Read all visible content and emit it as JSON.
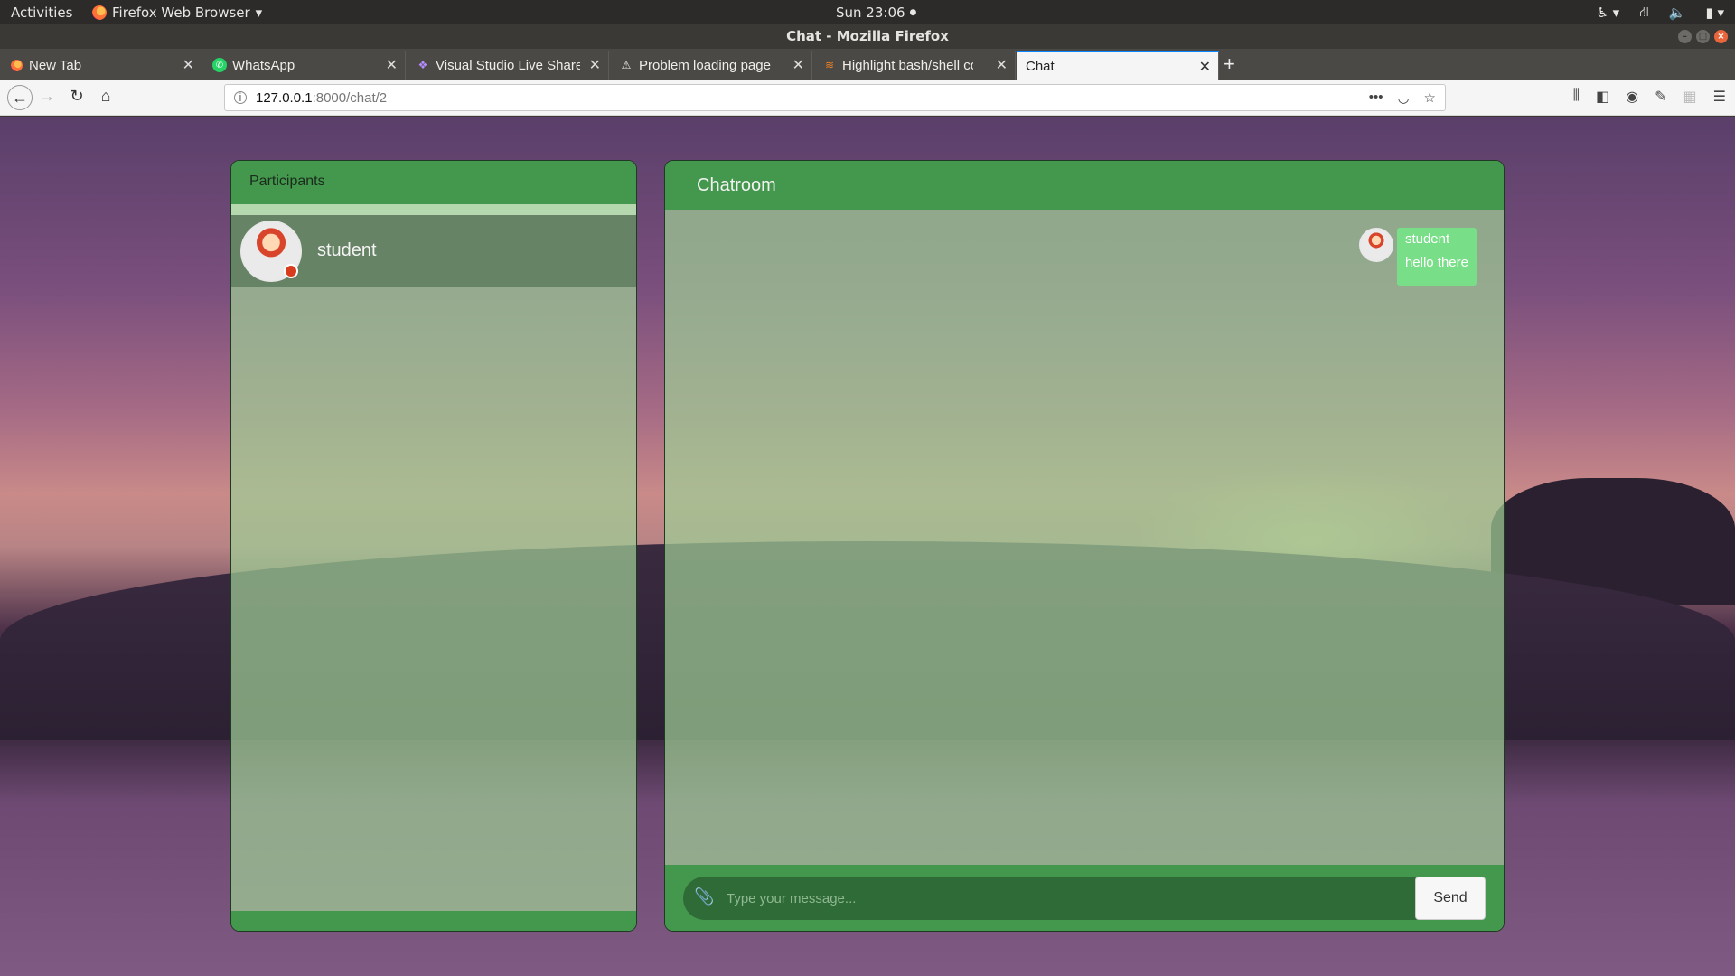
{
  "system": {
    "activities": "Activities",
    "app_menu": "Firefox Web Browser",
    "clock": "Sun 23:06"
  },
  "window": {
    "title": "Chat - Mozilla Firefox"
  },
  "tabs": [
    {
      "label": "New Tab",
      "icon": "firefox-icon"
    },
    {
      "label": "WhatsApp",
      "icon": "whatsapp-icon"
    },
    {
      "label": "Visual Studio Live Share",
      "icon": "liveshare-icon"
    },
    {
      "label": "Problem loading page",
      "icon": "warning-icon"
    },
    {
      "label": "Highlight bash/shell cod",
      "icon": "stackoverflow-icon"
    },
    {
      "label": "Chat",
      "icon": "none",
      "active": true
    }
  ],
  "urlbar": {
    "host": "127.0.0.1",
    "path": ":8000/chat/2"
  },
  "participants": {
    "title": "Participants",
    "list": [
      {
        "name": "student",
        "status": "busy"
      }
    ]
  },
  "chatroom": {
    "title": "Chatroom",
    "messages": [
      {
        "sender": "student",
        "text": "hello there"
      }
    ],
    "composer": {
      "placeholder": "Type your message...",
      "send_label": "Send"
    }
  },
  "colors": {
    "panel_header": "#43984d",
    "bubble": "#79de88",
    "status_busy": "#d83c1d",
    "composer_input": "#2f6b37"
  }
}
